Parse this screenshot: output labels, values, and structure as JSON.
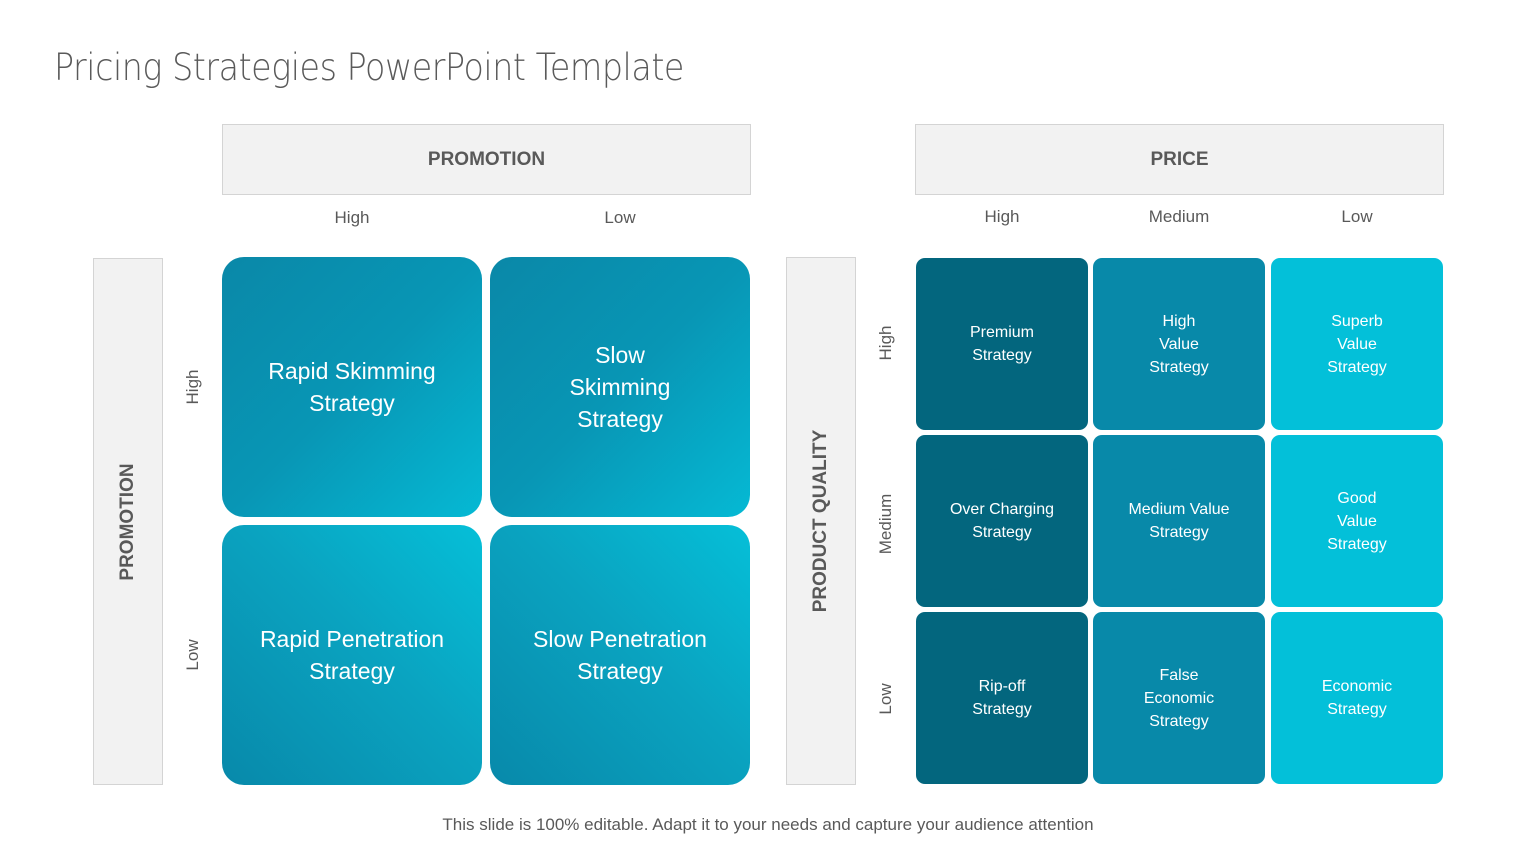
{
  "title": "Pricing Strategies PowerPoint Template",
  "left_matrix": {
    "top_header": "PROMOTION",
    "side_header": "PROMOTION",
    "col_labels": [
      "High",
      "Low"
    ],
    "row_labels": [
      "High",
      "Low"
    ],
    "cells": [
      [
        "Rapid Skimming\nStrategy",
        "Slow\nSkimming\nStrategy"
      ],
      [
        "Rapid Penetration\nStrategy",
        "Slow Penetration\nStrategy"
      ]
    ]
  },
  "right_matrix": {
    "top_header": "PRICE",
    "side_header": "PRODUCT QUALITY",
    "col_labels": [
      "High",
      "Medium",
      "Low"
    ],
    "row_labels": [
      "High",
      "Medium",
      "Low"
    ],
    "column_colors": [
      "#03667e",
      "#0889a9",
      "#03c0d9"
    ],
    "cells": [
      [
        "Premium\nStrategy",
        "High\nValue\nStrategy",
        "Superb\nValue\nStrategy"
      ],
      [
        "Over Charging\nStrategy",
        "Medium Value\nStrategy",
        "Good\nValue\nStrategy"
      ],
      [
        "Rip-off\nStrategy",
        "False\nEconomic\nStrategy",
        "Economic\nStrategy"
      ]
    ]
  },
  "footer": "This slide is 100% editable. Adapt it to your needs and capture your audience attention"
}
